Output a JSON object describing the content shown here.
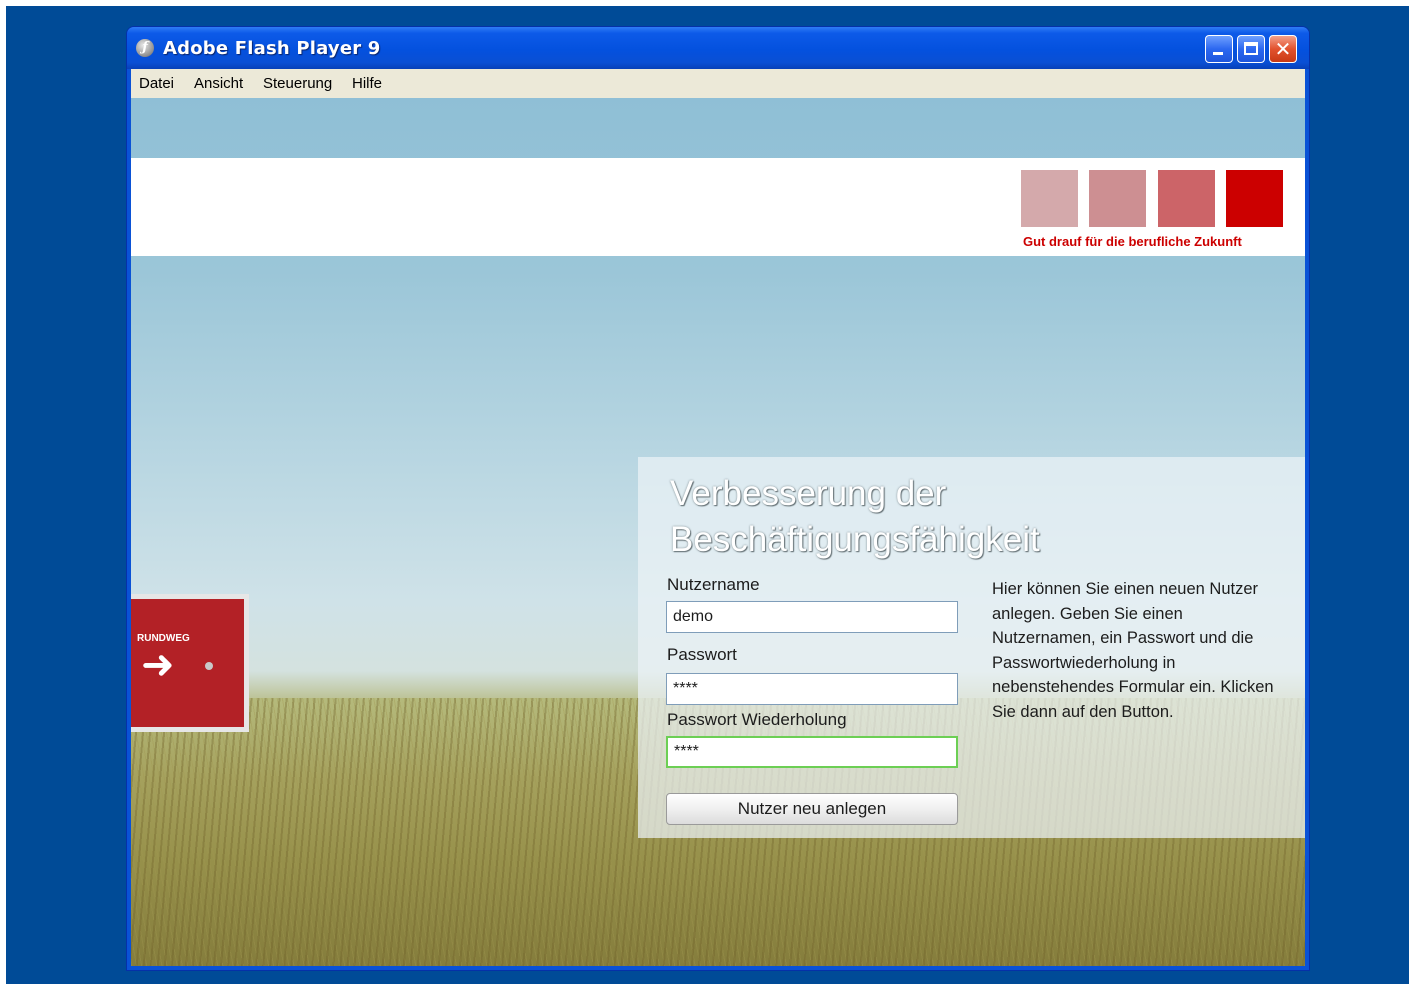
{
  "window": {
    "title": "Adobe Flash Player 9",
    "icon": "flash-player-icon",
    "controls": {
      "minimize": "minimize-icon",
      "maximize": "maximize-icon",
      "close": "✕"
    }
  },
  "menu": {
    "items": [
      {
        "label": "Datei"
      },
      {
        "label": "Ansicht"
      },
      {
        "label": "Steuerung"
      },
      {
        "label": "Hilfe"
      }
    ]
  },
  "brand": {
    "tagline": "Gut drauf für die berufliche Zukunft",
    "squares": [
      "#d4a9ab",
      "#cd8f92",
      "#cc6468",
      "#cc0000"
    ]
  },
  "sign": {
    "label": "RUNDWEG",
    "arrow": "➜"
  },
  "form": {
    "title": "Verbesserung der Beschäftigungsfähigkeit",
    "username_label": "Nutzername",
    "username_value": "demo",
    "password_label": "Passwort",
    "password_value": "****",
    "password_repeat_label": "Passwort Wiederholung",
    "password_repeat_value": "****",
    "submit_label": "Nutzer neu anlegen",
    "help_text": "Hier können Sie einen neuen Nutzer anlegen. Geben Sie einen Nutzernamen, ein Passwort und die Passwortwiederholung in nebenstehendes Formular ein. Klicken Sie dann auf den Button."
  },
  "colors": {
    "desktop": "#004b97",
    "titlebar": "#0451de",
    "brand_red": "#cc0000",
    "active_field_border": "#6ccf54"
  }
}
